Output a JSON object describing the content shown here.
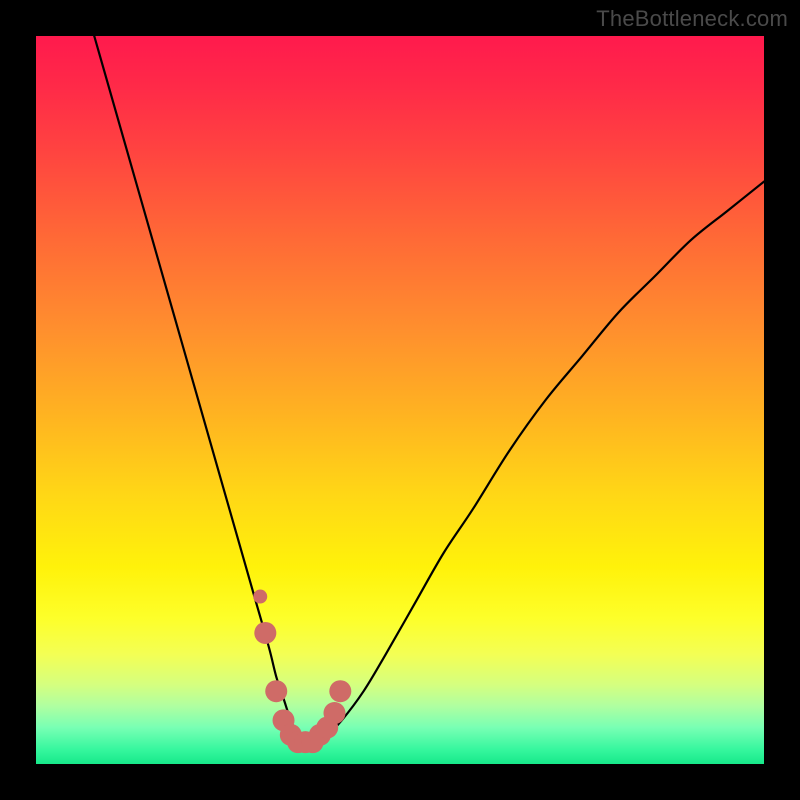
{
  "watermark": "TheBottleneck.com",
  "colors": {
    "frame": "#000000",
    "curve": "#000000",
    "dots": "#cf6b67",
    "gradient_top": "#ff1a4d",
    "gradient_bottom": "#17e98a"
  },
  "chart_data": {
    "type": "line",
    "title": "",
    "xlabel": "",
    "ylabel": "",
    "xlim": [
      0,
      100
    ],
    "ylim": [
      0,
      100
    ],
    "series": [
      {
        "name": "bottleneck-curve",
        "x": [
          8,
          10,
          12,
          14,
          16,
          18,
          20,
          22,
          24,
          26,
          28,
          30,
          32,
          33,
          34,
          35,
          36,
          37,
          38,
          40,
          42,
          45,
          48,
          52,
          56,
          60,
          65,
          70,
          75,
          80,
          85,
          90,
          95,
          100
        ],
        "y": [
          100,
          93,
          86,
          79,
          72,
          65,
          58,
          51,
          44,
          37,
          30,
          23,
          16,
          12,
          9,
          6,
          4,
          3,
          3,
          4,
          6,
          10,
          15,
          22,
          29,
          35,
          43,
          50,
          56,
          62,
          67,
          72,
          76,
          80
        ]
      }
    ],
    "markers": [
      {
        "name": "highlight-dots",
        "x": [
          31.5,
          33.0,
          34.0,
          35.0,
          36.0,
          37.0,
          38.0,
          39.0,
          40.0,
          41.0,
          41.8
        ],
        "y": [
          18,
          10,
          6,
          4,
          3,
          3,
          3,
          4,
          5,
          7,
          10
        ]
      }
    ]
  }
}
